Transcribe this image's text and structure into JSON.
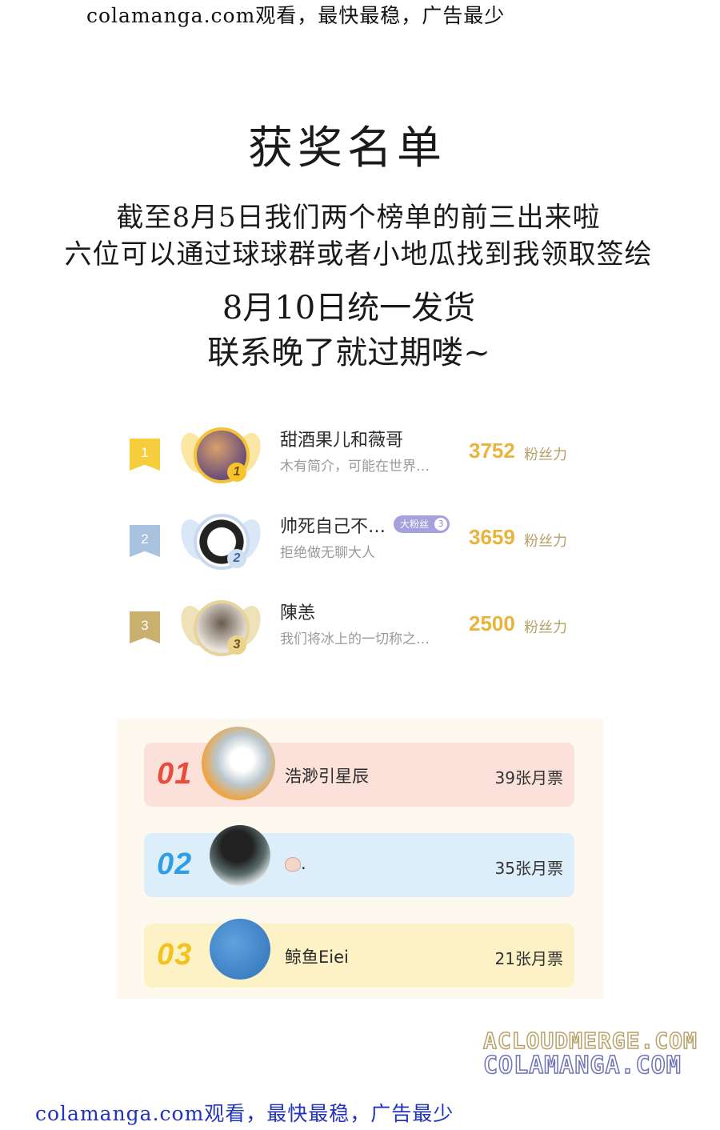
{
  "watermark_top": "colamanga.com观看，最快最稳，广告最少",
  "watermark_bottom": "colamanga.com观看，最快最稳，广告最少",
  "title": "获奖名单",
  "lines": [
    "截至8月5日我们两个榜单的前三出来啦",
    "六位可以通过球球群或者小地瓜找到我领取签绘",
    "8月10日统一发货",
    "联系晚了就过期喽~"
  ],
  "fan_ranking": [
    {
      "rank": "1",
      "name": "甜酒果儿和薇哥",
      "desc": "木有简介，可能在世界…",
      "score": "3752",
      "unit": "粉丝力"
    },
    {
      "rank": "2",
      "name": "帅死自己不…",
      "badge": "大粉丝",
      "badge_level": "3",
      "desc": "拒绝做无聊大人",
      "score": "3659",
      "unit": "粉丝力"
    },
    {
      "rank": "3",
      "name": "陳恙",
      "desc": "我们将冰上的一切称之…",
      "score": "2500",
      "unit": "粉丝力"
    }
  ],
  "monthly_ticket": [
    {
      "rank": "01",
      "name": "浩渺引星辰",
      "votes": "39张月票"
    },
    {
      "rank": "02",
      "name": ".",
      "votes": "35张月票"
    },
    {
      "rank": "03",
      "name": "鲸鱼Eiei",
      "votes": "21张月票"
    }
  ],
  "site_watermark": [
    "ACLOUDMERGE.COM",
    "COLAMANGA.COM"
  ]
}
